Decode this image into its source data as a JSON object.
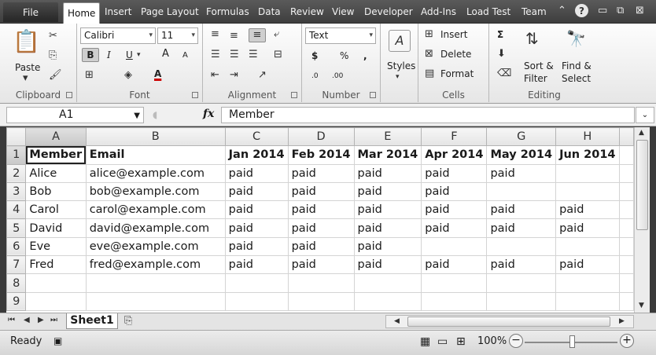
{
  "menu": {
    "file": "File",
    "tabs": [
      "Home",
      "Insert",
      "Page Layout",
      "Formulas",
      "Data",
      "Review",
      "View",
      "Developer",
      "Add-Ins",
      "Load Test",
      "Team"
    ]
  },
  "ribbon": {
    "clipboard": {
      "paste": "Paste",
      "label": "Clipboard"
    },
    "font": {
      "name": "Calibri",
      "size": "11",
      "bold": "B",
      "italic": "I",
      "underline": "U",
      "grow": "A",
      "shrink": "A",
      "color": "A",
      "label": "Font"
    },
    "alignment": {
      "label": "Alignment"
    },
    "number": {
      "format": "Text",
      "currency": "$",
      "percent": "%",
      "comma": ",",
      "inc_dec": ".0",
      "dec_dec": ".00",
      "label": "Number"
    },
    "styles": {
      "label": "Styles"
    },
    "cells": {
      "insert": "Insert",
      "delete": "Delete",
      "format": "Format",
      "label": "Cells"
    },
    "editing": {
      "sum": "Σ",
      "sort": "Sort &",
      "sort2": "Filter",
      "find": "Find &",
      "find2": "Select",
      "label": "Editing"
    }
  },
  "formula_bar": {
    "cell_ref": "A1",
    "fx": "fx",
    "content": "Member"
  },
  "grid": {
    "columns": [
      "A",
      "B",
      "C",
      "D",
      "E",
      "F",
      "G",
      "H"
    ],
    "rows": [
      {
        "num": "1",
        "cells": [
          "Member",
          "Email",
          "Jan 2014",
          "Feb 2014",
          "Mar 2014",
          "Apr 2014",
          "May 2014",
          "Jun 2014"
        ]
      },
      {
        "num": "2",
        "cells": [
          "Alice",
          "alice@example.com",
          "paid",
          "paid",
          "paid",
          "paid",
          "paid",
          ""
        ]
      },
      {
        "num": "3",
        "cells": [
          "Bob",
          "bob@example.com",
          "paid",
          "paid",
          "paid",
          "paid",
          "",
          ""
        ]
      },
      {
        "num": "4",
        "cells": [
          "Carol",
          "carol@example.com",
          "paid",
          "paid",
          "paid",
          "paid",
          "paid",
          "paid"
        ]
      },
      {
        "num": "5",
        "cells": [
          "David",
          "david@example.com",
          "paid",
          "paid",
          "paid",
          "paid",
          "paid",
          "paid"
        ]
      },
      {
        "num": "6",
        "cells": [
          "Eve",
          "eve@example.com",
          "paid",
          "paid",
          "paid",
          "",
          "",
          ""
        ]
      },
      {
        "num": "7",
        "cells": [
          "Fred",
          "fred@example.com",
          "paid",
          "paid",
          "paid",
          "paid",
          "paid",
          "paid"
        ]
      },
      {
        "num": "8",
        "cells": [
          "",
          "",
          "",
          "",
          "",
          "",
          "",
          ""
        ]
      },
      {
        "num": "9",
        "cells": [
          "",
          "",
          "",
          "",
          "",
          "",
          "",
          ""
        ]
      }
    ]
  },
  "sheet_tabs": {
    "active": "Sheet1"
  },
  "status": {
    "ready": "Ready",
    "zoom": "100%",
    "minus": "−",
    "plus": "+"
  }
}
